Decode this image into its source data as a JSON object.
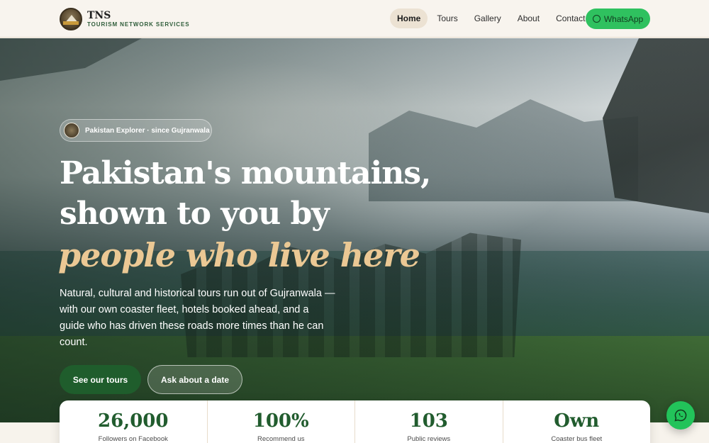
{
  "brand": {
    "name": "TNS",
    "tagline": "TOURISM NETWORK SERVICES"
  },
  "nav": {
    "items": [
      {
        "label": "Home",
        "active": true
      },
      {
        "label": "Tours",
        "active": false
      },
      {
        "label": "Gallery",
        "active": false
      },
      {
        "label": "About",
        "active": false
      },
      {
        "label": "Contact",
        "active": false
      }
    ],
    "whatsapp_label": "WhatsApp"
  },
  "hero": {
    "badge": "Pakistan Explorer · since Gujranwala",
    "headline_line1": "Pakistan's mountains,",
    "headline_line2": "shown to you by",
    "headline_accent": "people who live here",
    "subtext": "Natural, cultural and historical tours run out of Gujranwala — with our own coaster fleet, hotels booked ahead, and a guide who has driven these roads more times than he can count.",
    "primary_button": "See our tours",
    "secondary_button": "Ask about a date"
  },
  "stats": [
    {
      "value": "26,000",
      "label": "Followers on Facebook"
    },
    {
      "value": "100%",
      "label": "Recommend us"
    },
    {
      "value": "103",
      "label": "Public reviews"
    },
    {
      "value": "Own",
      "label": "Coaster bus fleet"
    }
  ],
  "colors": {
    "brand_green": "#215c2e",
    "whatsapp_green": "#2fc15f",
    "accent_gold": "#ebc894"
  }
}
